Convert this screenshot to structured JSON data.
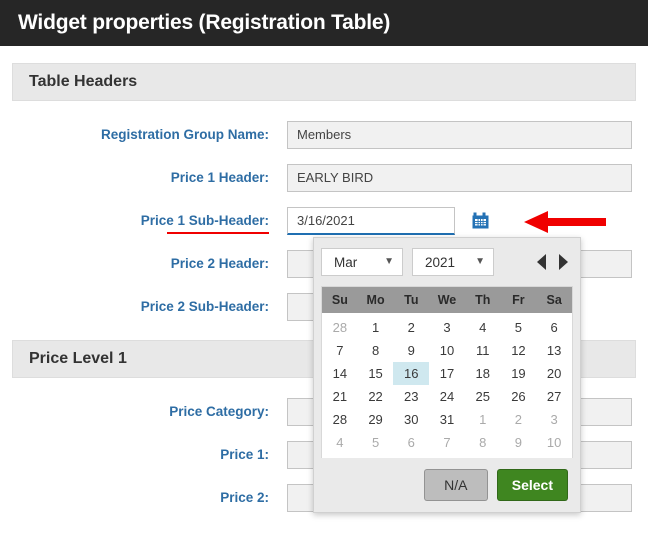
{
  "window": {
    "title": "Widget properties (Registration Table)"
  },
  "sections": {
    "table_headers": {
      "title": "Table Headers",
      "fields": [
        {
          "label": "Registration Group Name:",
          "value": "Members"
        },
        {
          "label": "Price 1 Header:",
          "value": "EARLY BIRD"
        },
        {
          "label": "Price 1 Sub-Header:",
          "value": "3/16/2021"
        },
        {
          "label": "Price 2 Header:",
          "value": ""
        },
        {
          "label": "Price 2 Sub-Header:",
          "value": ""
        }
      ]
    },
    "price_level_1": {
      "title": "Price Level 1",
      "fields": [
        {
          "label": "Price Category:",
          "value": ""
        },
        {
          "label": "Price 1:",
          "value": ""
        },
        {
          "label": "Price 2:",
          "value": ""
        }
      ]
    }
  },
  "calendar_button": {
    "icon": "calendar-icon"
  },
  "datepicker": {
    "month": "Mar",
    "year": "2021",
    "prev_label": "prev-month-arrow",
    "next_label": "next-month-arrow",
    "weekdays": [
      "Su",
      "Mo",
      "Tu",
      "We",
      "Th",
      "Fr",
      "Sa"
    ],
    "weeks": [
      [
        {
          "d": "28",
          "other": true
        },
        {
          "d": "1"
        },
        {
          "d": "2"
        },
        {
          "d": "3"
        },
        {
          "d": "4"
        },
        {
          "d": "5"
        },
        {
          "d": "6"
        }
      ],
      [
        {
          "d": "7"
        },
        {
          "d": "8"
        },
        {
          "d": "9"
        },
        {
          "d": "10"
        },
        {
          "d": "11"
        },
        {
          "d": "12"
        },
        {
          "d": "13"
        }
      ],
      [
        {
          "d": "14"
        },
        {
          "d": "15"
        },
        {
          "d": "16",
          "selected": true
        },
        {
          "d": "17"
        },
        {
          "d": "18"
        },
        {
          "d": "19"
        },
        {
          "d": "20"
        }
      ],
      [
        {
          "d": "21"
        },
        {
          "d": "22"
        },
        {
          "d": "23"
        },
        {
          "d": "24"
        },
        {
          "d": "25"
        },
        {
          "d": "26"
        },
        {
          "d": "27"
        }
      ],
      [
        {
          "d": "28"
        },
        {
          "d": "29"
        },
        {
          "d": "30"
        },
        {
          "d": "31"
        },
        {
          "d": "1",
          "other": true
        },
        {
          "d": "2",
          "other": true
        },
        {
          "d": "3",
          "other": true
        }
      ],
      [
        {
          "d": "4",
          "other": true
        },
        {
          "d": "5",
          "other": true
        },
        {
          "d": "6",
          "other": true
        },
        {
          "d": "7",
          "other": true
        },
        {
          "d": "8",
          "other": true
        },
        {
          "d": "9",
          "other": true
        },
        {
          "d": "10",
          "other": true
        }
      ]
    ],
    "na_label": "N/A",
    "select_label": "Select"
  },
  "annotations": {
    "arrow": "red-arrow-pointing-to-calendar-icon",
    "underline": "red-underline-under-price-1-sub-header-label"
  },
  "colors": {
    "titlebar_bg": "#262626",
    "label_blue": "#2e6da4",
    "annotation_red": "#f00000",
    "select_green": "#3f8620",
    "selected_day": "#cfe8ef",
    "weekday_header": "#9a9a9a",
    "calendar_icon_blue": "#2472b5",
    "active_input_underline": "#1f6fb2"
  }
}
